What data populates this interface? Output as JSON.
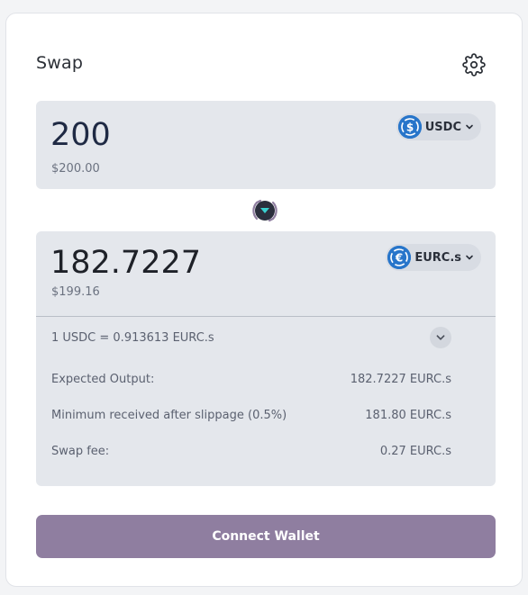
{
  "header": {
    "title": "Swap",
    "settings_icon": "gear-icon"
  },
  "from": {
    "amount": "200",
    "fiat_value": "$200.00",
    "token": {
      "symbol": "USDC",
      "icon": "usdc-icon",
      "color": "#2775ca"
    }
  },
  "switch": {
    "icon": "swap-direction-icon"
  },
  "to": {
    "amount": "182.7227",
    "fiat_value": "$199.16",
    "token": {
      "symbol": "EURC.s",
      "icon": "eurc-icon",
      "color": "#2775ca"
    }
  },
  "details": {
    "rate": "1 USDC = 0.913613 EURC.s",
    "rows": [
      {
        "label": "Expected Output:",
        "value": "182.7227 EURC.s"
      },
      {
        "label": "Minimum received after slippage (0.5%)",
        "value": "181.80 EURC.s"
      },
      {
        "label": "Swap fee:",
        "value": "0.27 EURC.s"
      }
    ]
  },
  "cta": {
    "label": "Connect Wallet",
    "color": "#8f7ea0"
  }
}
